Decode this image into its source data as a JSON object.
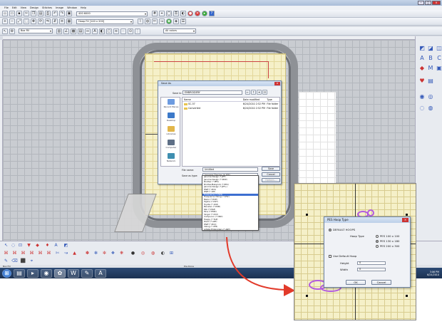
{
  "window": {
    "title": "",
    "menu": [
      "File",
      "Edit",
      "View",
      "Design",
      "Stitches",
      "Image",
      "Window",
      "Help"
    ]
  },
  "toolbar": {
    "format_combo": "400 6000",
    "hoop_combo": "Hoop FX [140 x 200]",
    "size_combo": "Box Fill",
    "view_combo": "All colors"
  },
  "save_dialog": {
    "title": "Save As",
    "save_in_label": "Save in:",
    "save_in_value": "EMBROIDERY",
    "places": [
      "Recent Places",
      "Desktop",
      "Libraries",
      "Computer",
      "Network"
    ],
    "columns": [
      "Name",
      "Date modified",
      "Type"
    ],
    "rows": [
      {
        "name": "SC-57",
        "date": "6/24/2010 2:52 PM",
        "type": "File folder"
      },
      {
        "name": "Converted",
        "date": "6/24/2010 2:52 PM",
        "type": "File folder"
      }
    ],
    "filename_label": "File name:",
    "filename_value": "Untitled",
    "filetype_label": "Save as type:",
    "filetype_value": "Janome Design (*.JEF)",
    "save_button": "Save",
    "cancel_button": "Cancel",
    "options_button": "Options..."
  },
  "filetype_dropdown": [
    "Janome Design (*.JEF)",
    "Janome Design (*.SEW)",
    "Brother (*.PES)",
    "Brother/Babylock (*.PEC)",
    "Janome Design (*.JEF+)",
    "Pfaff (*.PCS)",
    "Pfaff (*.VIP)",
    "Husqvarna (*.HUS)",
    "Husqvarna Viking (*.SHV)",
    "Melco (*.EXP)",
    "Tajima (*.DST)",
    "Toyota (*.10O)",
    "Barudan (*.DSB)",
    "Zsk (*.DSZ)",
    "Elna (*.EMD)",
    "Singer (*.XXX)",
    "Compucon (*.CND)",
    "Happy (*.TAP)",
    "Poem (*.ART)",
    "Pfaff (*.PCQ)",
    "Viking (*.VP3)",
    "Artista Embroidery (*.ART)",
    "Janome (*.JPX)",
    "Janome (*.JEF)"
  ],
  "status": {
    "text": "Box Fill",
    "center": "Pos Done"
  },
  "clock": {
    "time": "3:06 PM",
    "date": "6/24/2010"
  },
  "zoom_dialog": {
    "title": "PES Hoop Type",
    "option_default": "DEFAULT HOOPS",
    "hoop_type_label": "Hoop Type",
    "hoop_options": [
      "PES 100 x 100",
      "PES 130 x 180",
      "PES 200 x 300"
    ],
    "hoop_selected": 1,
    "checkbox_label": "Use Default Hoop",
    "height_label": "Height",
    "width_label": "Width",
    "height_value": "0",
    "width_value": "0",
    "ok_button": "OK",
    "cancel_button": "Cancel"
  },
  "colors": {
    "accent_arrow": "#e23a2a",
    "stitch_area": "#f5f0c8",
    "selection": "#3d6fd1",
    "design_purple": "#b25be0"
  }
}
